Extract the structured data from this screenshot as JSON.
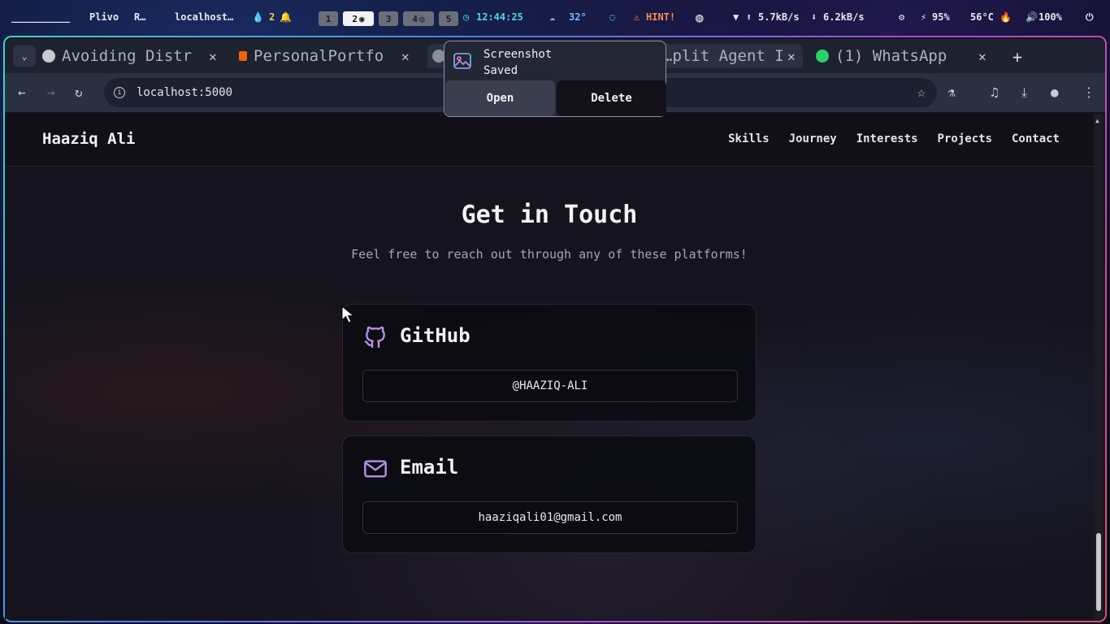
{
  "system_bar": {
    "workspace_label": "__________",
    "window_1": "Plivo",
    "window_2": "R…",
    "window_3": "localhost…",
    "notif_count": "2",
    "workspaces": [
      "1",
      "2",
      "3",
      "4",
      "5"
    ],
    "clock": "12:44:25",
    "weather": "32°",
    "hint": "HINT!",
    "net_up": "5.7kB/s",
    "net_down": "6.2kB/s",
    "battery": "95%",
    "temperature": "56°C",
    "volume": "100%"
  },
  "tabs": [
    {
      "title": "Avoiding Distr",
      "icon": "ai-icon"
    },
    {
      "title": "PersonalPortfo",
      "icon": "replit-icon"
    },
    {
      "title": "…plit Agent I",
      "icon": "globe-icon"
    },
    {
      "title": "(1) WhatsApp",
      "icon": "whatsapp-icon"
    }
  ],
  "address_bar": {
    "url": "localhost:5000"
  },
  "notification": {
    "title_line1": "Screenshot",
    "title_line2": "Saved",
    "open_label": "Open",
    "delete_label": "Delete"
  },
  "site": {
    "brand": "Haaziq Ali",
    "nav": [
      "Skills",
      "Journey",
      "Interests",
      "Projects",
      "Contact"
    ],
    "heading": "Get in Touch",
    "subheading": "Feel free to reach out through any of these platforms!",
    "cards": [
      {
        "title": "GitHub",
        "value": "@HAAZIQ-ALI",
        "icon": "github-icon"
      },
      {
        "title": "Email",
        "value": "haaziqali01@gmail.com",
        "icon": "mail-icon"
      }
    ]
  },
  "colors": {
    "accent_purple": "#b98ee8",
    "page_bg": "#15131d",
    "tab_bar": "#1e2130"
  }
}
